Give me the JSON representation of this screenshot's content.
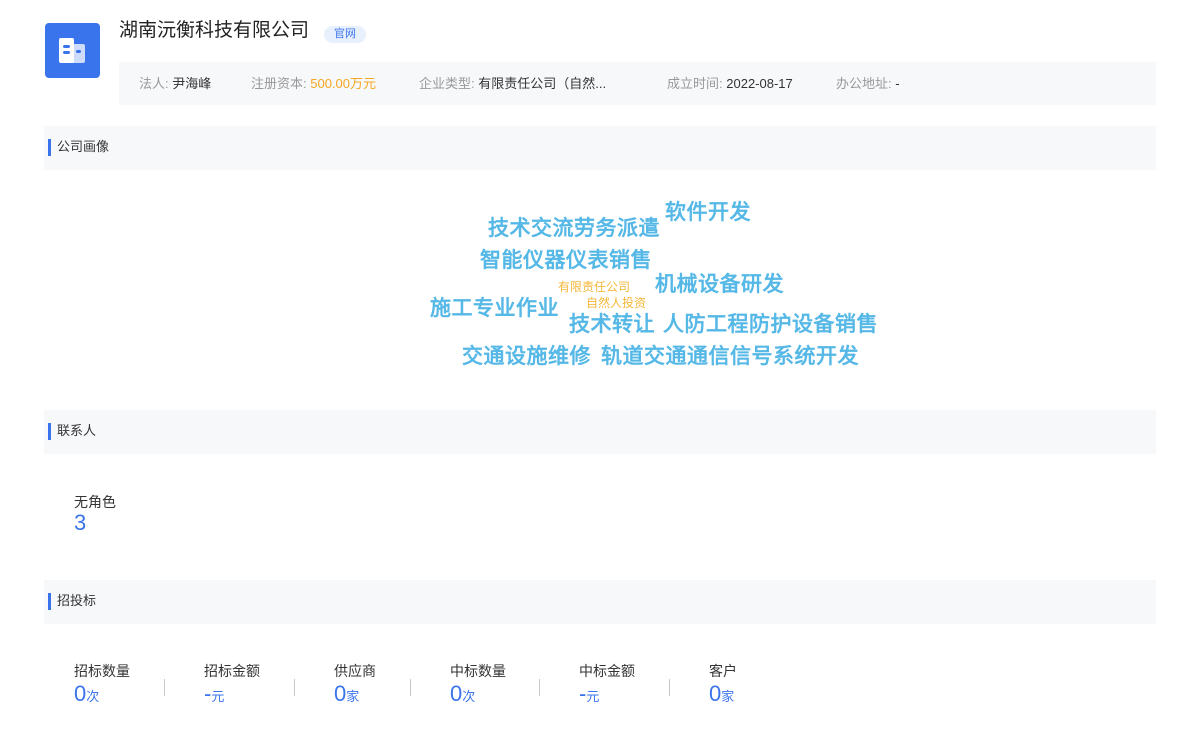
{
  "company": {
    "name": "湖南沅衡科技有限公司",
    "website_badge": "官网",
    "logo_icon": "building-icon",
    "accent_color": "#3a74ec"
  },
  "info": {
    "legal_rep_label": "法人:",
    "legal_rep": "尹海峰",
    "capital_label": "注册资本:",
    "capital": "500.00万元",
    "type_label": "企业类型:",
    "type": "有限责任公司（自然...",
    "founded_label": "成立时间:",
    "founded": "2022-08-17",
    "address_label": "办公地址:",
    "address": "-"
  },
  "profile": {
    "title": "公司画像",
    "tags": [
      "技术交流劳务派遣",
      "软件开发",
      "智能仪器仪表销售",
      "有限责任公司",
      "机械设备研发",
      "自然人投资",
      "施工专业作业",
      "技术转让",
      "人防工程防护设备销售",
      "交通设施维修",
      "轨道交通通信信号系统开发"
    ]
  },
  "contacts": {
    "title": "联系人",
    "role_label": "无角色",
    "role_count": "3"
  },
  "bidding": {
    "title": "招投标",
    "stats": [
      {
        "label": "招标数量",
        "value": "0",
        "unit": "次"
      },
      {
        "label": "招标金额",
        "value": "-",
        "unit": "元"
      },
      {
        "label": "供应商",
        "value": "0",
        "unit": "家"
      },
      {
        "label": "中标数量",
        "value": "0",
        "unit": "次"
      },
      {
        "label": "中标金额",
        "value": "-",
        "unit": "元"
      },
      {
        "label": "客户",
        "value": "0",
        "unit": "家"
      }
    ]
  }
}
